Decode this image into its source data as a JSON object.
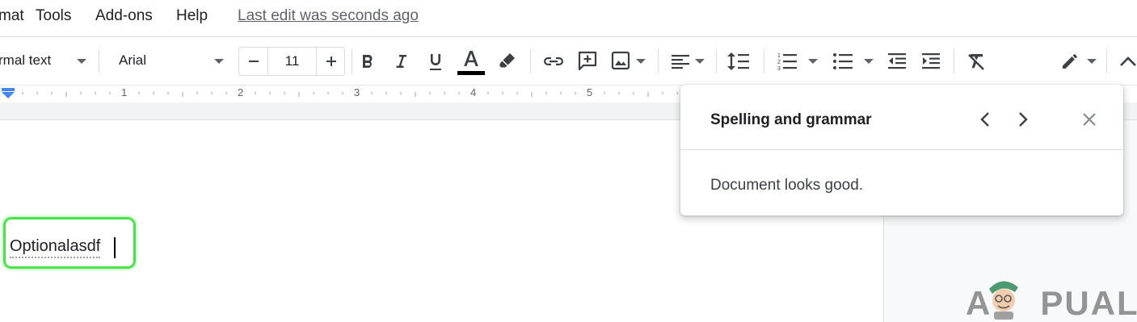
{
  "menubar": {
    "items": [
      "mat",
      "Tools",
      "Add-ons",
      "Help"
    ],
    "last_edit": "Last edit was seconds ago"
  },
  "toolbar": {
    "style_value": "rmal text",
    "font_value": "Arial",
    "font_size": "11",
    "icons": [
      "decrease-font-size",
      "increase-font-size",
      "bold",
      "italic",
      "underline",
      "text-color",
      "highlight-color",
      "insert-link",
      "add-comment",
      "insert-image",
      "align",
      "line-spacing",
      "numbered-list",
      "bulleted-list",
      "decrease-indent",
      "increase-indent",
      "clear-formatting",
      "editing-mode",
      "collapse-menus"
    ],
    "text_color_bar": "#000000"
  },
  "ruler": {
    "numbers": [
      "1",
      "2",
      "3",
      "4",
      "5"
    ],
    "indent_marker_color": "#4285f4"
  },
  "document": {
    "text": "Optionalasdf",
    "highlight_color": "#4be34b"
  },
  "spelling_panel": {
    "title": "Spelling and grammar",
    "message": "Document looks good."
  },
  "watermark": {
    "text_left": "A",
    "text_right": "PUALS"
  }
}
